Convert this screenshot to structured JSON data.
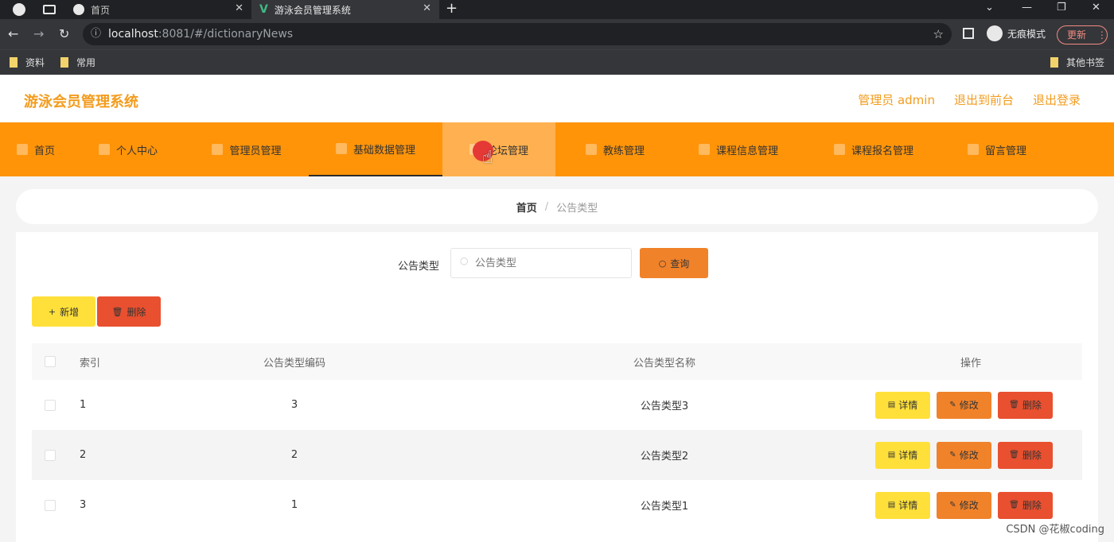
{
  "browser": {
    "tabs": [
      {
        "label": "首页"
      },
      {
        "label": "游泳会员管理系统"
      }
    ],
    "url_host": "localhost",
    "url_port_path": ":8081/#/dictionaryNews",
    "incognito_label": "无痕模式",
    "update_label": "更新",
    "bookmarks": [
      "资料",
      "常用"
    ],
    "other_bookmarks": "其他书签"
  },
  "app": {
    "title": "游泳会员管理系统",
    "header_links": [
      "管理员 admin",
      "退出到前台",
      "退出登录"
    ]
  },
  "menu": {
    "items": [
      {
        "label": "首页"
      },
      {
        "label": "个人中心"
      },
      {
        "label": "管理员管理"
      },
      {
        "label": "基础数据管理"
      },
      {
        "label": "论坛管理"
      },
      {
        "label": "教练管理"
      },
      {
        "label": "课程信息管理"
      },
      {
        "label": "课程报名管理"
      },
      {
        "label": "留言管理"
      }
    ]
  },
  "breadcrumb": {
    "home": "首页",
    "separator": "/",
    "current": "公告类型"
  },
  "search": {
    "label": "公告类型",
    "placeholder": "公告类型",
    "query_label": "查询"
  },
  "actions": {
    "add_label": "新增",
    "delete_label": "删除"
  },
  "table": {
    "headers": {
      "index": "索引",
      "code": "公告类型编码",
      "name": "公告类型名称",
      "ops": "操作"
    },
    "rows": [
      {
        "index": "1",
        "code": "3",
        "name": "公告类型3"
      },
      {
        "index": "2",
        "code": "2",
        "name": "公告类型2"
      },
      {
        "index": "3",
        "code": "1",
        "name": "公告类型1"
      }
    ],
    "op_labels": {
      "detail": "详情",
      "edit": "修改",
      "delete": "删除"
    }
  },
  "watermark": "CSDN @花椒coding",
  "colors": {
    "accent": "#ff9409",
    "title": "#f39c1e",
    "yellow": "#ffe03a",
    "orange": "#f0822a",
    "red": "#e8502f"
  }
}
